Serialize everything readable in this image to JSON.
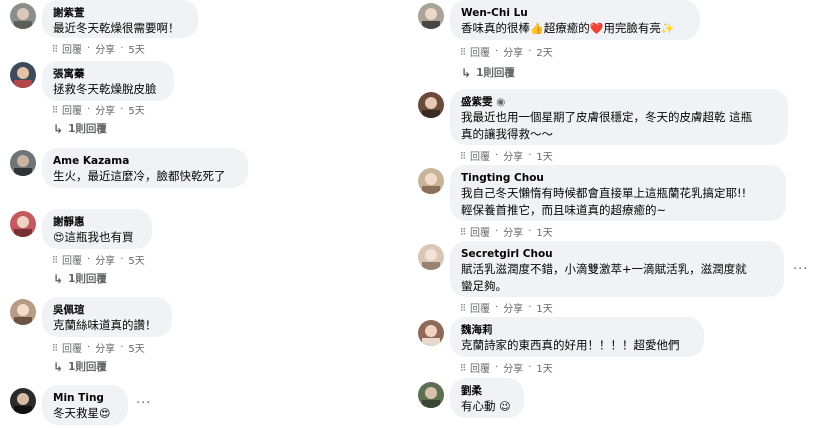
{
  "actions": {
    "react_icon": "⁝⁝",
    "reply": "回覆",
    "share": "分享",
    "dot": "·"
  },
  "left": [
    {
      "name": "謝紫萱",
      "text": "最近冬天乾燥很需要啊！",
      "time": "5天"
    },
    {
      "name": "張寓蓁",
      "text": "拯救冬天乾燥脫皮臉",
      "time": "5天",
      "replies": "1則回覆"
    },
    {
      "name": "Ame Kazama",
      "text": "生火，最近這麼冷，臉都快乾死了"
    },
    {
      "name": "謝靜惠",
      "text_pre": "😍",
      "text": "這瓶我也有買",
      "time": "5天",
      "replies": "1則回覆"
    },
    {
      "name": "吳佩瑄",
      "text": "克蘭絲味道真的讚！",
      "time": "5天",
      "replies": "1則回覆"
    },
    {
      "name": "Min Ting",
      "text": "冬天救星",
      "text_post": "😍",
      "more": "···"
    }
  ],
  "right": [
    {
      "name": "Wen-Chi Lu",
      "text": "香味真的很棒",
      "emoji1": "👍",
      "text2": "超療癒的",
      "emoji2": "❤️",
      "text3": "用完臉有亮",
      "emoji3": "✨",
      "time": "2天",
      "replies": "1則回覆"
    },
    {
      "name": "盛紫雯",
      "name_badge": "◉",
      "line1": "我最近也用一個星期了皮膚很穩定，冬天的皮膚超乾 這瓶",
      "line2": "真的讓我得救～～",
      "time": "1天"
    },
    {
      "name": "Tingting Chou",
      "line1": "我自己冬天懶惰有時候都會直接單上這瓶蘭花乳搞定耶!!",
      "line2": "輕保養首推它，而且味道真的超療癒的~",
      "time": "1天"
    },
    {
      "name": "Secretgirl Chou",
      "line1": "賦活乳滋潤度不錯，小滴雙激萃+一滴賦活乳，滋潤度就",
      "line2": "蠻足夠。",
      "time": "1天",
      "more": "···"
    },
    {
      "name": "魏海莉",
      "text": "克蘭詩家的東西真的好用！！！！超愛他們",
      "time": "1天"
    },
    {
      "name": "劉柔",
      "text": "有心動",
      "text_post": "😉"
    }
  ]
}
